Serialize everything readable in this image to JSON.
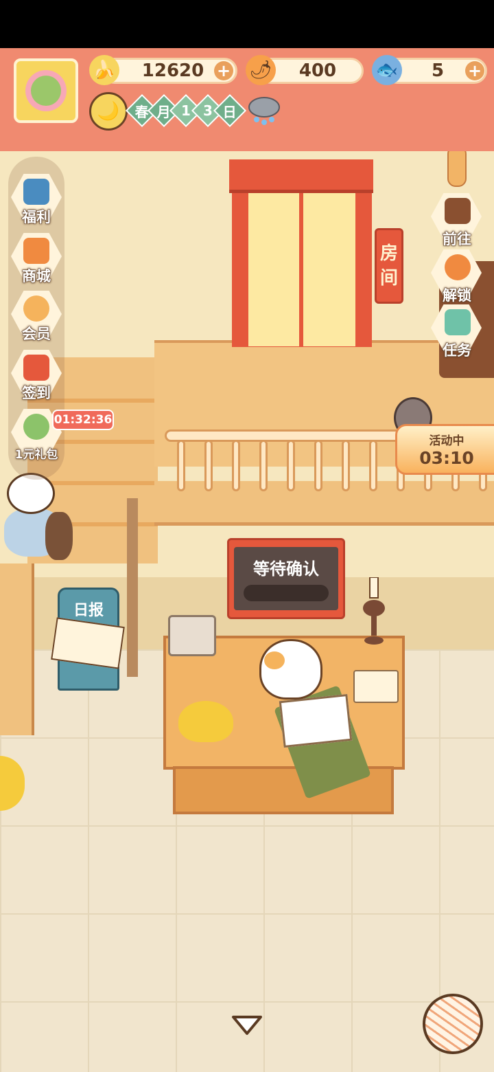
{
  "header": {
    "bananas": {
      "value": "12620",
      "icon": "banana-icon"
    },
    "fire_peppers": {
      "value": "400",
      "icon": "fire-pepper-icon"
    },
    "blue_fish": {
      "value": "5",
      "icon": "blue-fish-icon"
    },
    "plus_label": "+",
    "date": {
      "season": "春",
      "month_label": "月",
      "day_digit_1": "1",
      "day_digit_2": "3",
      "day_label": "日"
    },
    "weather_icon": "rain-cloud-icon"
  },
  "left_menu": {
    "items": [
      {
        "label": "福利",
        "icon": "tv-play-icon"
      },
      {
        "label": "商城",
        "icon": "shop-icon"
      },
      {
        "label": "会员",
        "icon": "flower-badge-icon"
      },
      {
        "label": "签到",
        "icon": "calendar-check-icon"
      },
      {
        "label": "1元礼包",
        "icon": "gift-flower-icon"
      }
    ],
    "gift_timer": "01:32:36",
    "collapse_icon": "chevron-up-icon"
  },
  "right_menu": {
    "items": [
      {
        "label": "前往",
        "icon": "signboard-icon"
      },
      {
        "label": "解锁",
        "icon": "key-icon"
      },
      {
        "label": "任务",
        "icon": "task-jar-icon"
      }
    ]
  },
  "event": {
    "title": "活动中",
    "time": "03:10"
  },
  "room_sign": "房间",
  "newsstand_label": "日报",
  "board": {
    "text": "等待确认"
  },
  "bottom": {
    "toggle_icon": "triangle-down-icon",
    "yarn_icon": "yarn-ball-icon"
  },
  "colors": {
    "header": "#f08a70",
    "wall": "#f6e7bf",
    "floor": "#f1e5cd",
    "wood": "#f2c482",
    "door_red": "#e5583c",
    "timer_red": "#f06a5a",
    "event_orange": "#f9b25d"
  }
}
